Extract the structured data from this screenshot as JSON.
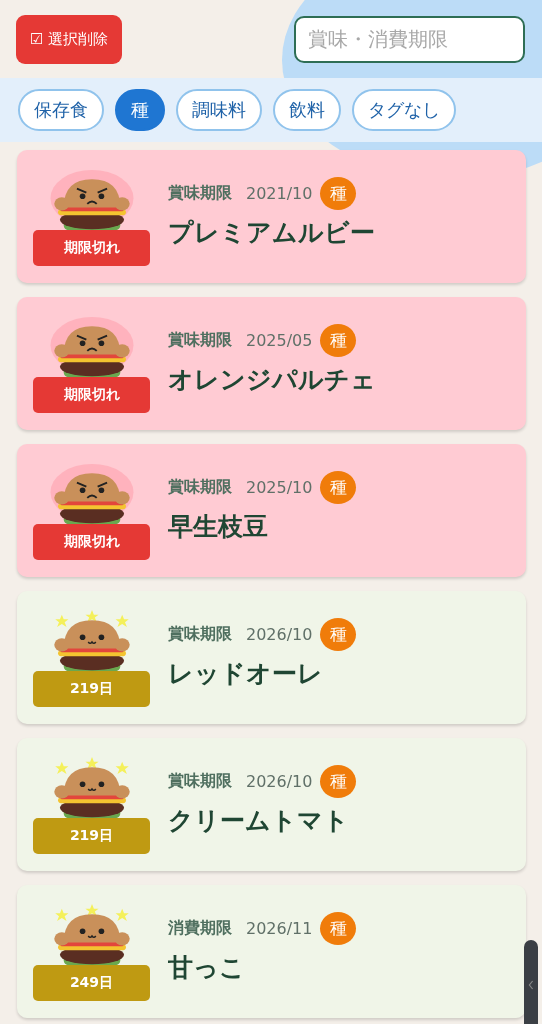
{
  "delete_button": {
    "label": "☑ 選択削除"
  },
  "search": {
    "placeholder": "賞味・消費期限"
  },
  "tags": [
    {
      "label": "保存食",
      "selected": false
    },
    {
      "label": "種",
      "selected": true
    },
    {
      "label": "調味料",
      "selected": false
    },
    {
      "label": "飲料",
      "selected": false
    },
    {
      "label": "タグなし",
      "selected": false
    }
  ],
  "items": [
    {
      "expired": true,
      "badge": "期限切れ",
      "date_kind": "賞味期限",
      "date": "2021/10",
      "tag": "種",
      "name": "プレミアムルビー"
    },
    {
      "expired": true,
      "badge": "期限切れ",
      "date_kind": "賞味期限",
      "date": "2025/05",
      "tag": "種",
      "name": "オレンジパルチェ"
    },
    {
      "expired": true,
      "badge": "期限切れ",
      "date_kind": "賞味期限",
      "date": "2025/10",
      "tag": "種",
      "name": "早生枝豆"
    },
    {
      "expired": false,
      "badge": "219日",
      "date_kind": "賞味期限",
      "date": "2026/10",
      "tag": "種",
      "name": "レッドオーレ"
    },
    {
      "expired": false,
      "badge": "219日",
      "date_kind": "賞味期限",
      "date": "2026/10",
      "tag": "種",
      "name": "クリームトマト"
    },
    {
      "expired": false,
      "badge": "249日",
      "date_kind": "消費期限",
      "date": "2026/11",
      "tag": "種",
      "name": "甘っこ"
    }
  ]
}
